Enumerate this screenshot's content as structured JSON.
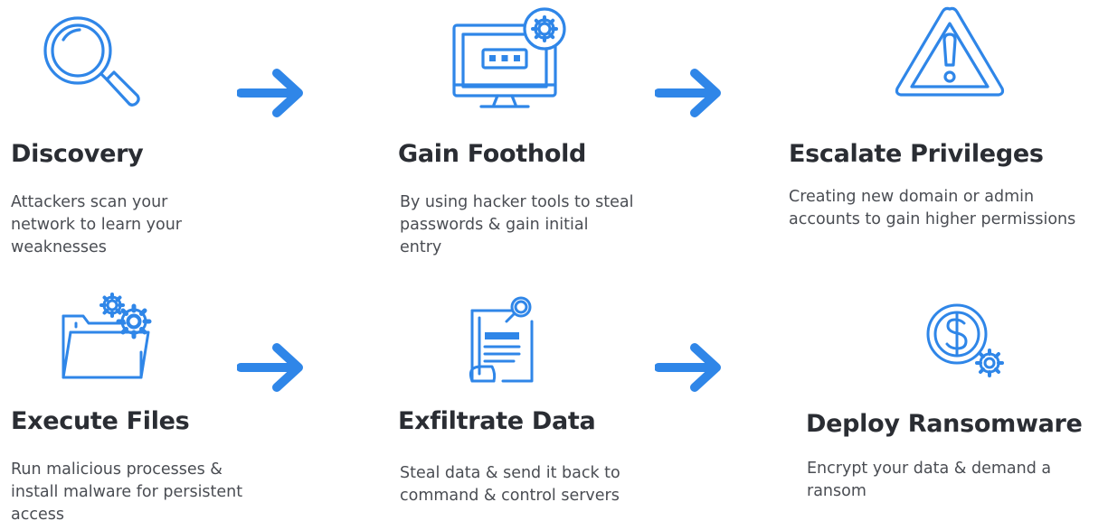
{
  "colors": {
    "icon_stroke": "#2f86e8",
    "arrow": "#2f86e8",
    "title": "#2a2d33",
    "text": "#4a4d53"
  },
  "stages": [
    {
      "icon": "magnifier-icon",
      "title": "Discovery",
      "description": "Attackers scan your network to learn your weaknesses"
    },
    {
      "icon": "monitor-gear-icon",
      "title": "Gain Foothold",
      "description": "By using hacker tools to steal passwords & gain initial entry"
    },
    {
      "icon": "warning-triangle-icon",
      "title": "Escalate Privileges",
      "description": "Creating new domain or admin accounts to gain higher permissions"
    },
    {
      "icon": "folder-gears-icon",
      "title": "Execute Files",
      "description": "Run malicious processes & install malware for persistent access"
    },
    {
      "icon": "document-search-icon",
      "title": "Exfiltrate Data",
      "description": "Steal data & send it back to command & control servers"
    },
    {
      "icon": "dollar-gear-icon",
      "title": "Deploy Ransomware",
      "description": "Encrypt your data & demand a ransom"
    }
  ]
}
